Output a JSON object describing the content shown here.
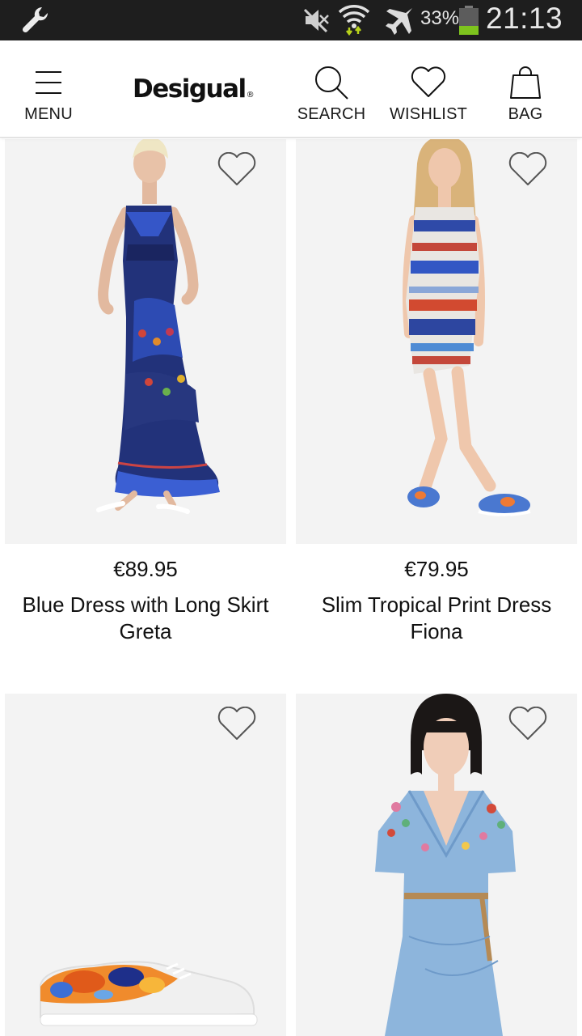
{
  "status_bar": {
    "battery_percent": "33%",
    "battery_level": 0.33,
    "time": "21:13",
    "icons": [
      "wrench-icon",
      "mute-icon",
      "wifi-icon",
      "airplane-icon",
      "battery-icon"
    ]
  },
  "header": {
    "menu_label": "MENU",
    "logo_text": "Desigual",
    "logo_mark": "®",
    "search_label": "SEARCH",
    "wishlist_label": "WISHLIST",
    "bag_label": "BAG"
  },
  "products": [
    {
      "price": "€89.95",
      "name": "Blue Dress with Long Skirt Greta",
      "image": "model-in-blue-long-dress"
    },
    {
      "price": "€79.95",
      "name": "Slim Tropical Print Dress Fiona",
      "image": "model-in-printed-short-dress"
    },
    {
      "price": "",
      "name": "",
      "image": "floral-print-sneaker"
    },
    {
      "price": "",
      "name": "",
      "image": "model-in-light-blue-embroidered-wrap-dress"
    }
  ],
  "colors": {
    "status_bar_bg": "#1e1e1e",
    "status_text": "#e8e8e8",
    "battery_fill": "#7ec41e",
    "wifi_arrows": "#b8d21b",
    "card_bg": "#f3f3f3"
  }
}
